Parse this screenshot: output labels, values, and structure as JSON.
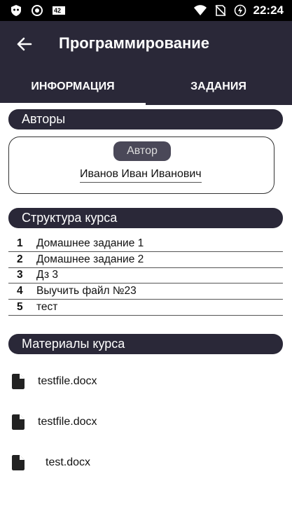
{
  "status_bar": {
    "time": "22:24",
    "notification_badge": "42",
    "icons": [
      "shield-icon",
      "record-icon",
      "notification-badge-icon",
      "wifi-icon",
      "no-sim-icon",
      "battery-icon"
    ]
  },
  "app_bar": {
    "title": "Программирование",
    "back_icon": "arrow-left-icon"
  },
  "tabs": [
    {
      "label": "ИНФОРМАЦИЯ",
      "active": true
    },
    {
      "label": "ЗАДАНИЯ",
      "active": false
    }
  ],
  "authors": {
    "header": "Авторы",
    "chip_label": "Автор",
    "name": "Иванов Иван Иванович"
  },
  "course_structure": {
    "header": "Структура курса",
    "items": [
      {
        "num": "1",
        "name": "Домашнее задание 1"
      },
      {
        "num": "2",
        "name": "Домашнее задание 2"
      },
      {
        "num": "3",
        "name": "Дз 3"
      },
      {
        "num": "4",
        "name": "Выучить файл №23"
      },
      {
        "num": "5",
        "name": "тест"
      }
    ]
  },
  "materials": {
    "header": "Материалы курса",
    "files": [
      {
        "name": "testfile.docx",
        "icon": "file-icon"
      },
      {
        "name": "testfile.docx",
        "icon": "file-icon"
      },
      {
        "name": "test.docx",
        "icon": "file-icon"
      }
    ]
  },
  "colors": {
    "primary_dark": "#2a2838",
    "chip": "#4a4858",
    "status_bar": "#000000"
  }
}
